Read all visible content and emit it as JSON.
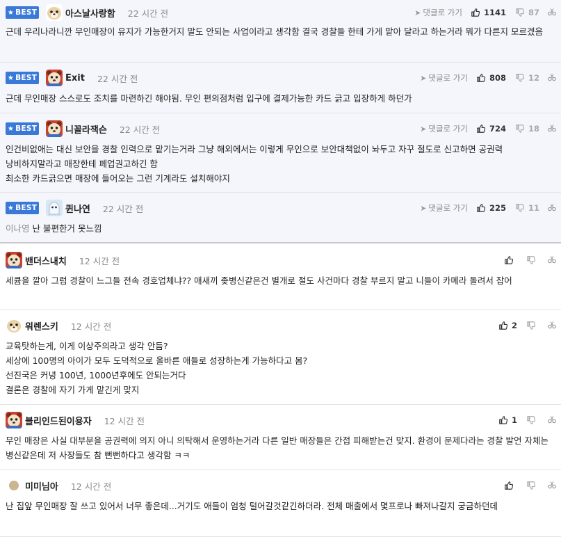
{
  "comments": [
    {
      "best": true,
      "badge": "BEST",
      "avatar": "dog-face",
      "nickname": "아스날사랑함",
      "time": "22 시간 전",
      "reply_label": "댓글로 가기",
      "upvotes": "1141",
      "downvotes": "87",
      "text_lines": [
        "근데 우리나라니깐 무인매장이 유지가 가능한거지 말도 안되는 사업이라고 생각함 결국 경찰들 한테 가게 맡아 달라고 하는거라 뭐가 다른지 모르겠음"
      ],
      "mention": ""
    },
    {
      "best": true,
      "badge": "BEST",
      "avatar": "red-bear",
      "nickname": "Exit",
      "time": "22 시간 전",
      "reply_label": "댓글로 가기",
      "upvotes": "808",
      "downvotes": "12",
      "text_lines": [
        "근데 무인매장 스스로도 조치를 마련하긴 해야됨. 무인 편의점처럼 입구에 결제가능한 카드 긁고 입장하게 하던가"
      ],
      "mention": ""
    },
    {
      "best": true,
      "badge": "BEST",
      "avatar": "red-bear",
      "nickname": "니꼴라잭슨",
      "time": "22 시간 전",
      "reply_label": "댓글로 가기",
      "upvotes": "724",
      "downvotes": "18",
      "text_lines": [
        "인건비없애는 대신 보안을 경찰 인력으로 맡기는거라 그냥 해외에서는 이렇게 무인으로 보안대책없이 놔두고 자꾸 절도로 신고하면 공권력 낭비하지말라고 매장한테 폐업권고하긴 함",
        "최소한 카드긁으면 매장에 들어오는 그런 기계라도 설치해야지"
      ],
      "mention": ""
    },
    {
      "best": true,
      "badge": "BEST",
      "avatar": "ghost",
      "nickname": "퀸나연",
      "time": "22 시간 전",
      "reply_label": "댓글로 가기",
      "upvotes": "225",
      "downvotes": "11",
      "text_lines": [
        "난 불편한거 못느낌"
      ],
      "mention": "이나영"
    },
    {
      "best": false,
      "avatar": "red-bear",
      "nickname": "밴더스내치",
      "time": "12 시간 전",
      "upvotes": "",
      "downvotes": "",
      "text_lines": [
        "세큠을 깔아 그럼 경찰이 느그들 전속 경호업체냐?? 애새끼 좆병신같은건 별개로 절도 사건마다 경찰 부르지 말고 니들이 카메라 돌려서 잡어"
      ],
      "mention": ""
    },
    {
      "best": false,
      "avatar": "dog-face",
      "nickname": "워렌스키",
      "time": "12 시간 전",
      "upvotes": "2",
      "downvotes": "",
      "text_lines": [
        "교육탓하는게, 이게 이상주의라고 생각 안듬?",
        "세상에 100명의 아이가 모두 도덕적으로 올바른 애들로 성장하는게 가능하다고 봄?",
        "선진국은 커녕 100년, 1000년후에도 안되는거다",
        "결론은 경찰에 자기 가게 맡긴게 맞지"
      ],
      "mention": ""
    },
    {
      "best": false,
      "avatar": "red-bear",
      "nickname": "블리인드된이용자",
      "time": "12 시간 전",
      "upvotes": "1",
      "downvotes": "",
      "text_lines": [
        "무인 매장은 사실 대부분을 공권력에 의지 아니 의탁해서 운영하는거라 다른 일반 매장들은 간접 피해받는건 맞지. 환경이 문제다라는 경찰 발언 자체는 병신같은데 저 사장들도 참 뻔뻔하다고 생각함 ㅋㅋ"
      ],
      "mention": ""
    },
    {
      "best": false,
      "avatar": "plain-dot",
      "nickname": "미미님아",
      "time": "12 시간 전",
      "upvotes": "",
      "downvotes": "",
      "text_lines": [
        "난 집앞 무인매장 잘 쓰고 있어서 너무 좋은데...거기도 애들이 엄청 털어갈것같긴하더라. 전체 매출에서 몇프로나 빠져나갈지 궁금하던데"
      ],
      "mention": ""
    }
  ]
}
